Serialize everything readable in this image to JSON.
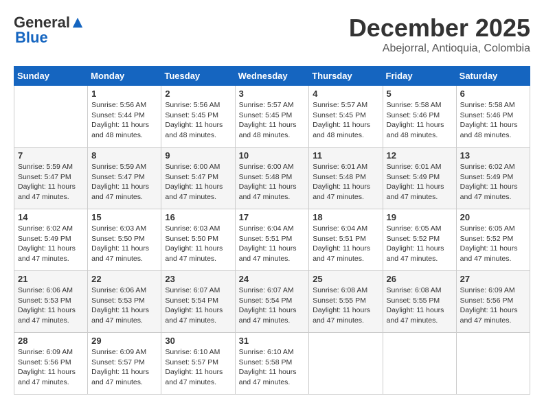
{
  "logo": {
    "general": "General",
    "blue": "Blue"
  },
  "title": {
    "month": "December 2025",
    "location": "Abejorral, Antioquia, Colombia"
  },
  "headers": [
    "Sunday",
    "Monday",
    "Tuesday",
    "Wednesday",
    "Thursday",
    "Friday",
    "Saturday"
  ],
  "weeks": [
    [
      {
        "day": "",
        "info": ""
      },
      {
        "day": "1",
        "info": "Sunrise: 5:56 AM\nSunset: 5:44 PM\nDaylight: 11 hours\nand 48 minutes."
      },
      {
        "day": "2",
        "info": "Sunrise: 5:56 AM\nSunset: 5:45 PM\nDaylight: 11 hours\nand 48 minutes."
      },
      {
        "day": "3",
        "info": "Sunrise: 5:57 AM\nSunset: 5:45 PM\nDaylight: 11 hours\nand 48 minutes."
      },
      {
        "day": "4",
        "info": "Sunrise: 5:57 AM\nSunset: 5:45 PM\nDaylight: 11 hours\nand 48 minutes."
      },
      {
        "day": "5",
        "info": "Sunrise: 5:58 AM\nSunset: 5:46 PM\nDaylight: 11 hours\nand 48 minutes."
      },
      {
        "day": "6",
        "info": "Sunrise: 5:58 AM\nSunset: 5:46 PM\nDaylight: 11 hours\nand 48 minutes."
      }
    ],
    [
      {
        "day": "7",
        "info": "Sunrise: 5:59 AM\nSunset: 5:47 PM\nDaylight: 11 hours\nand 47 minutes."
      },
      {
        "day": "8",
        "info": "Sunrise: 5:59 AM\nSunset: 5:47 PM\nDaylight: 11 hours\nand 47 minutes."
      },
      {
        "day": "9",
        "info": "Sunrise: 6:00 AM\nSunset: 5:47 PM\nDaylight: 11 hours\nand 47 minutes."
      },
      {
        "day": "10",
        "info": "Sunrise: 6:00 AM\nSunset: 5:48 PM\nDaylight: 11 hours\nand 47 minutes."
      },
      {
        "day": "11",
        "info": "Sunrise: 6:01 AM\nSunset: 5:48 PM\nDaylight: 11 hours\nand 47 minutes."
      },
      {
        "day": "12",
        "info": "Sunrise: 6:01 AM\nSunset: 5:49 PM\nDaylight: 11 hours\nand 47 minutes."
      },
      {
        "day": "13",
        "info": "Sunrise: 6:02 AM\nSunset: 5:49 PM\nDaylight: 11 hours\nand 47 minutes."
      }
    ],
    [
      {
        "day": "14",
        "info": "Sunrise: 6:02 AM\nSunset: 5:49 PM\nDaylight: 11 hours\nand 47 minutes."
      },
      {
        "day": "15",
        "info": "Sunrise: 6:03 AM\nSunset: 5:50 PM\nDaylight: 11 hours\nand 47 minutes."
      },
      {
        "day": "16",
        "info": "Sunrise: 6:03 AM\nSunset: 5:50 PM\nDaylight: 11 hours\nand 47 minutes."
      },
      {
        "day": "17",
        "info": "Sunrise: 6:04 AM\nSunset: 5:51 PM\nDaylight: 11 hours\nand 47 minutes."
      },
      {
        "day": "18",
        "info": "Sunrise: 6:04 AM\nSunset: 5:51 PM\nDaylight: 11 hours\nand 47 minutes."
      },
      {
        "day": "19",
        "info": "Sunrise: 6:05 AM\nSunset: 5:52 PM\nDaylight: 11 hours\nand 47 minutes."
      },
      {
        "day": "20",
        "info": "Sunrise: 6:05 AM\nSunset: 5:52 PM\nDaylight: 11 hours\nand 47 minutes."
      }
    ],
    [
      {
        "day": "21",
        "info": "Sunrise: 6:06 AM\nSunset: 5:53 PM\nDaylight: 11 hours\nand 47 minutes."
      },
      {
        "day": "22",
        "info": "Sunrise: 6:06 AM\nSunset: 5:53 PM\nDaylight: 11 hours\nand 47 minutes."
      },
      {
        "day": "23",
        "info": "Sunrise: 6:07 AM\nSunset: 5:54 PM\nDaylight: 11 hours\nand 47 minutes."
      },
      {
        "day": "24",
        "info": "Sunrise: 6:07 AM\nSunset: 5:54 PM\nDaylight: 11 hours\nand 47 minutes."
      },
      {
        "day": "25",
        "info": "Sunrise: 6:08 AM\nSunset: 5:55 PM\nDaylight: 11 hours\nand 47 minutes."
      },
      {
        "day": "26",
        "info": "Sunrise: 6:08 AM\nSunset: 5:55 PM\nDaylight: 11 hours\nand 47 minutes."
      },
      {
        "day": "27",
        "info": "Sunrise: 6:09 AM\nSunset: 5:56 PM\nDaylight: 11 hours\nand 47 minutes."
      }
    ],
    [
      {
        "day": "28",
        "info": "Sunrise: 6:09 AM\nSunset: 5:56 PM\nDaylight: 11 hours\nand 47 minutes."
      },
      {
        "day": "29",
        "info": "Sunrise: 6:09 AM\nSunset: 5:57 PM\nDaylight: 11 hours\nand 47 minutes."
      },
      {
        "day": "30",
        "info": "Sunrise: 6:10 AM\nSunset: 5:57 PM\nDaylight: 11 hours\nand 47 minutes."
      },
      {
        "day": "31",
        "info": "Sunrise: 6:10 AM\nSunset: 5:58 PM\nDaylight: 11 hours\nand 47 minutes."
      },
      {
        "day": "",
        "info": ""
      },
      {
        "day": "",
        "info": ""
      },
      {
        "day": "",
        "info": ""
      }
    ]
  ]
}
